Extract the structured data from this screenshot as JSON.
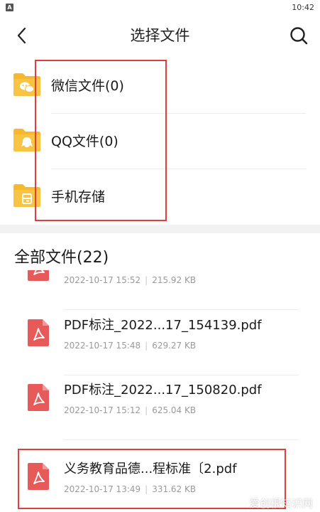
{
  "status_bar": {
    "badge": "A",
    "time": "10:42"
  },
  "header": {
    "title": "选择文件",
    "back_icon": "back-arrow-icon",
    "search_icon": "search-icon"
  },
  "sources": [
    {
      "label": "微信文件(0)",
      "icon": "wechat-folder-icon"
    },
    {
      "label": "QQ文件(0)",
      "icon": "qq-folder-icon"
    },
    {
      "label": "手机存储",
      "icon": "phone-storage-folder-icon"
    }
  ],
  "all_files": {
    "title": "全部文件(22)",
    "items": [
      {
        "name": "",
        "date": "2022-10-17 15:52",
        "size": "215.92 KB"
      },
      {
        "name": "PDF标注_2022...17_154139.pdf",
        "date": "2022-10-17 15:48",
        "size": "629.27 KB"
      },
      {
        "name": "PDF标注_2022...17_150820.pdf",
        "date": "2022-10-17 15:12",
        "size": "625.04 KB"
      },
      {
        "name": "义务教育品德...程标准〔2.pdf",
        "date": "2022-10-17 13:49",
        "size": "331.62 KB"
      }
    ]
  },
  "colors": {
    "folder": "#f5b82e",
    "pdf": "#e85a5a",
    "highlight": "#e53b3b"
  },
  "watermark": "爱创根知识网"
}
